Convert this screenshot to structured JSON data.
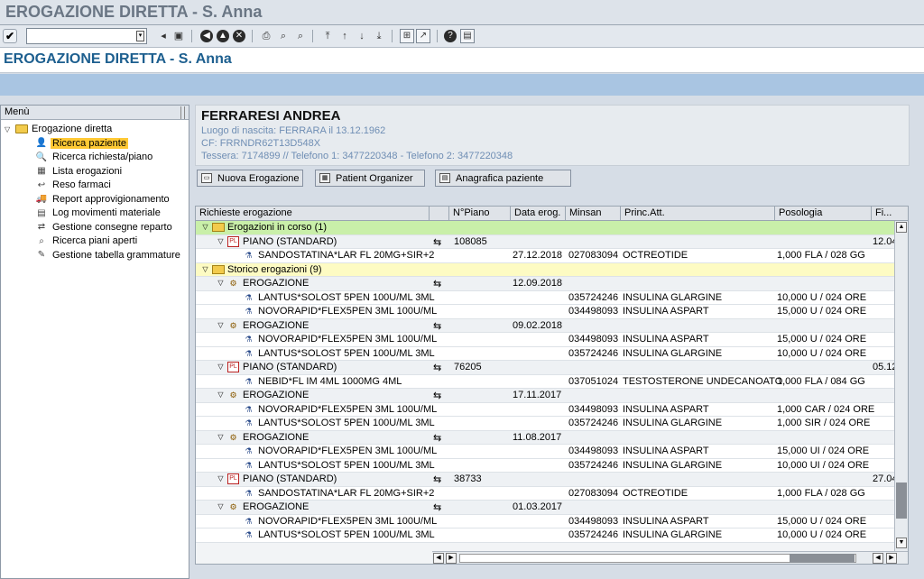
{
  "window": {
    "title": "EROGAZIONE DIRETTA - S. Anna"
  },
  "app": {
    "title": "EROGAZIONE DIRETTA - S. Anna"
  },
  "toolbar": {
    "command_value": ""
  },
  "sidebar": {
    "header": "Menù",
    "root": "Erogazione diretta",
    "items": [
      {
        "label": "Ricerca paziente",
        "icon": "person-icon",
        "selected": true
      },
      {
        "label": "Ricerca richiesta/piano",
        "icon": "search-doc-icon"
      },
      {
        "label": "Lista erogazioni",
        "icon": "list-icon"
      },
      {
        "label": "Reso farmaci",
        "icon": "return-icon"
      },
      {
        "label": "Report approvigionamento",
        "icon": "truck-icon"
      },
      {
        "label": "Log movimenti materiale",
        "icon": "log-icon"
      },
      {
        "label": "Gestione consegne reparto",
        "icon": "delivery-icon"
      },
      {
        "label": "Ricerca piani aperti",
        "icon": "plan-search-icon"
      },
      {
        "label": "Gestione tabella grammature",
        "icon": "edit-table-icon"
      }
    ]
  },
  "patient": {
    "name": "FERRARESI ANDREA",
    "birth": "Luogo di nascita: FERRARA il 13.12.1962",
    "cf": "CF: FRRNDR62T13D548X",
    "contacts": "Tessera: 7174899 // Telefono 1: 3477220348 - Telefono 2: 3477220348"
  },
  "buttons": {
    "nuova": "Nuova Erogazione",
    "organizer": "Patient Organizer",
    "anagrafica": "Anagrafica paziente"
  },
  "grid": {
    "columns": [
      "Richieste erogazione",
      "",
      "N°Piano",
      "Data erog.",
      "Minsan",
      "Princ.Att.",
      "Posologia",
      "Fi..."
    ],
    "rows": [
      {
        "kind": "g-green",
        "level": 0,
        "icon": "fold",
        "label": "Erogazioni in corso (1)"
      },
      {
        "kind": "grp",
        "level": 1,
        "icon": "piano",
        "label": "PIANO (STANDARD)",
        "link": true,
        "piano": "108085",
        "fine": "12.04"
      },
      {
        "kind": "item",
        "level": 2,
        "icon": "drug",
        "label": "SANDOSTATINA*LAR FL 20MG+SIR+2",
        "data": "27.12.2018",
        "minsan": "027083094",
        "princ": "OCTREOTIDE",
        "poso": "1,000 FLA / 028 GG"
      },
      {
        "kind": "g-yellow",
        "level": 0,
        "icon": "fold",
        "label": "Storico erogazioni (9)"
      },
      {
        "kind": "grp",
        "level": 1,
        "icon": "erog",
        "label": "EROGAZIONE",
        "link": true,
        "data": "12.09.2018"
      },
      {
        "kind": "item",
        "level": 2,
        "icon": "drug",
        "label": "LANTUS*SOLOST 5PEN 100U/ML 3ML",
        "minsan": "035724246",
        "princ": "INSULINA GLARGINE",
        "poso": "10,000 U / 024 ORE"
      },
      {
        "kind": "item",
        "level": 2,
        "icon": "drug",
        "label": "NOVORAPID*FLEX5PEN 3ML 100U/ML",
        "minsan": "034498093",
        "princ": "INSULINA ASPART",
        "poso": "15,000 U / 024 ORE"
      },
      {
        "kind": "grp",
        "level": 1,
        "icon": "erog",
        "label": "EROGAZIONE",
        "link": true,
        "data": "09.02.2018"
      },
      {
        "kind": "item",
        "level": 2,
        "icon": "drug",
        "label": "NOVORAPID*FLEX5PEN 3ML 100U/ML",
        "minsan": "034498093",
        "princ": "INSULINA ASPART",
        "poso": "15,000 U / 024 ORE"
      },
      {
        "kind": "item",
        "level": 2,
        "icon": "drug",
        "label": "LANTUS*SOLOST 5PEN 100U/ML 3ML",
        "minsan": "035724246",
        "princ": "INSULINA GLARGINE",
        "poso": "10,000 U / 024 ORE"
      },
      {
        "kind": "grp",
        "level": 1,
        "icon": "piano",
        "label": "PIANO (STANDARD)",
        "link": true,
        "piano": "76205",
        "fine": "05.12"
      },
      {
        "kind": "item",
        "level": 2,
        "icon": "drug",
        "label": "NEBID*FL IM 4ML 1000MG 4ML",
        "minsan": "037051024",
        "princ": "TESTOSTERONE UNDECANOATO",
        "poso": "1,000 FLA / 084 GG"
      },
      {
        "kind": "grp",
        "level": 1,
        "icon": "erog",
        "label": "EROGAZIONE",
        "link": true,
        "data": "17.11.2017"
      },
      {
        "kind": "item",
        "level": 2,
        "icon": "drug",
        "label": "NOVORAPID*FLEX5PEN 3ML 100U/ML",
        "minsan": "034498093",
        "princ": "INSULINA ASPART",
        "poso": "1,000 CAR / 024 ORE"
      },
      {
        "kind": "item",
        "level": 2,
        "icon": "drug",
        "label": "LANTUS*SOLOST 5PEN 100U/ML 3ML",
        "minsan": "035724246",
        "princ": "INSULINA GLARGINE",
        "poso": "1,000 SIR / 024 ORE"
      },
      {
        "kind": "grp",
        "level": 1,
        "icon": "erog",
        "label": "EROGAZIONE",
        "link": true,
        "data": "11.08.2017"
      },
      {
        "kind": "item",
        "level": 2,
        "icon": "drug",
        "label": "NOVORAPID*FLEX5PEN 3ML 100U/ML",
        "minsan": "034498093",
        "princ": "INSULINA ASPART",
        "poso": "15,000 UI / 024 ORE"
      },
      {
        "kind": "item",
        "level": 2,
        "icon": "drug",
        "label": "LANTUS*SOLOST 5PEN 100U/ML 3ML",
        "minsan": "035724246",
        "princ": "INSULINA GLARGINE",
        "poso": "10,000 UI / 024 ORE"
      },
      {
        "kind": "grp",
        "level": 1,
        "icon": "piano",
        "label": "PIANO (STANDARD)",
        "link": true,
        "piano": "38733",
        "fine": "27.04"
      },
      {
        "kind": "item",
        "level": 2,
        "icon": "drug",
        "label": "SANDOSTATINA*LAR FL 20MG+SIR+2",
        "minsan": "027083094",
        "princ": "OCTREOTIDE",
        "poso": "1,000 FLA / 028 GG"
      },
      {
        "kind": "grp",
        "level": 1,
        "icon": "erog",
        "label": "EROGAZIONE",
        "link": true,
        "data": "01.03.2017"
      },
      {
        "kind": "item",
        "level": 2,
        "icon": "drug",
        "label": "NOVORAPID*FLEX5PEN 3ML 100U/ML",
        "minsan": "034498093",
        "princ": "INSULINA ASPART",
        "poso": "15,000 U / 024 ORE"
      },
      {
        "kind": "item",
        "level": 2,
        "icon": "drug",
        "label": "LANTUS*SOLOST 5PEN 100U/ML 3ML",
        "minsan": "035724246",
        "princ": "INSULINA GLARGINE",
        "poso": "10,000 U / 024 ORE"
      }
    ]
  }
}
